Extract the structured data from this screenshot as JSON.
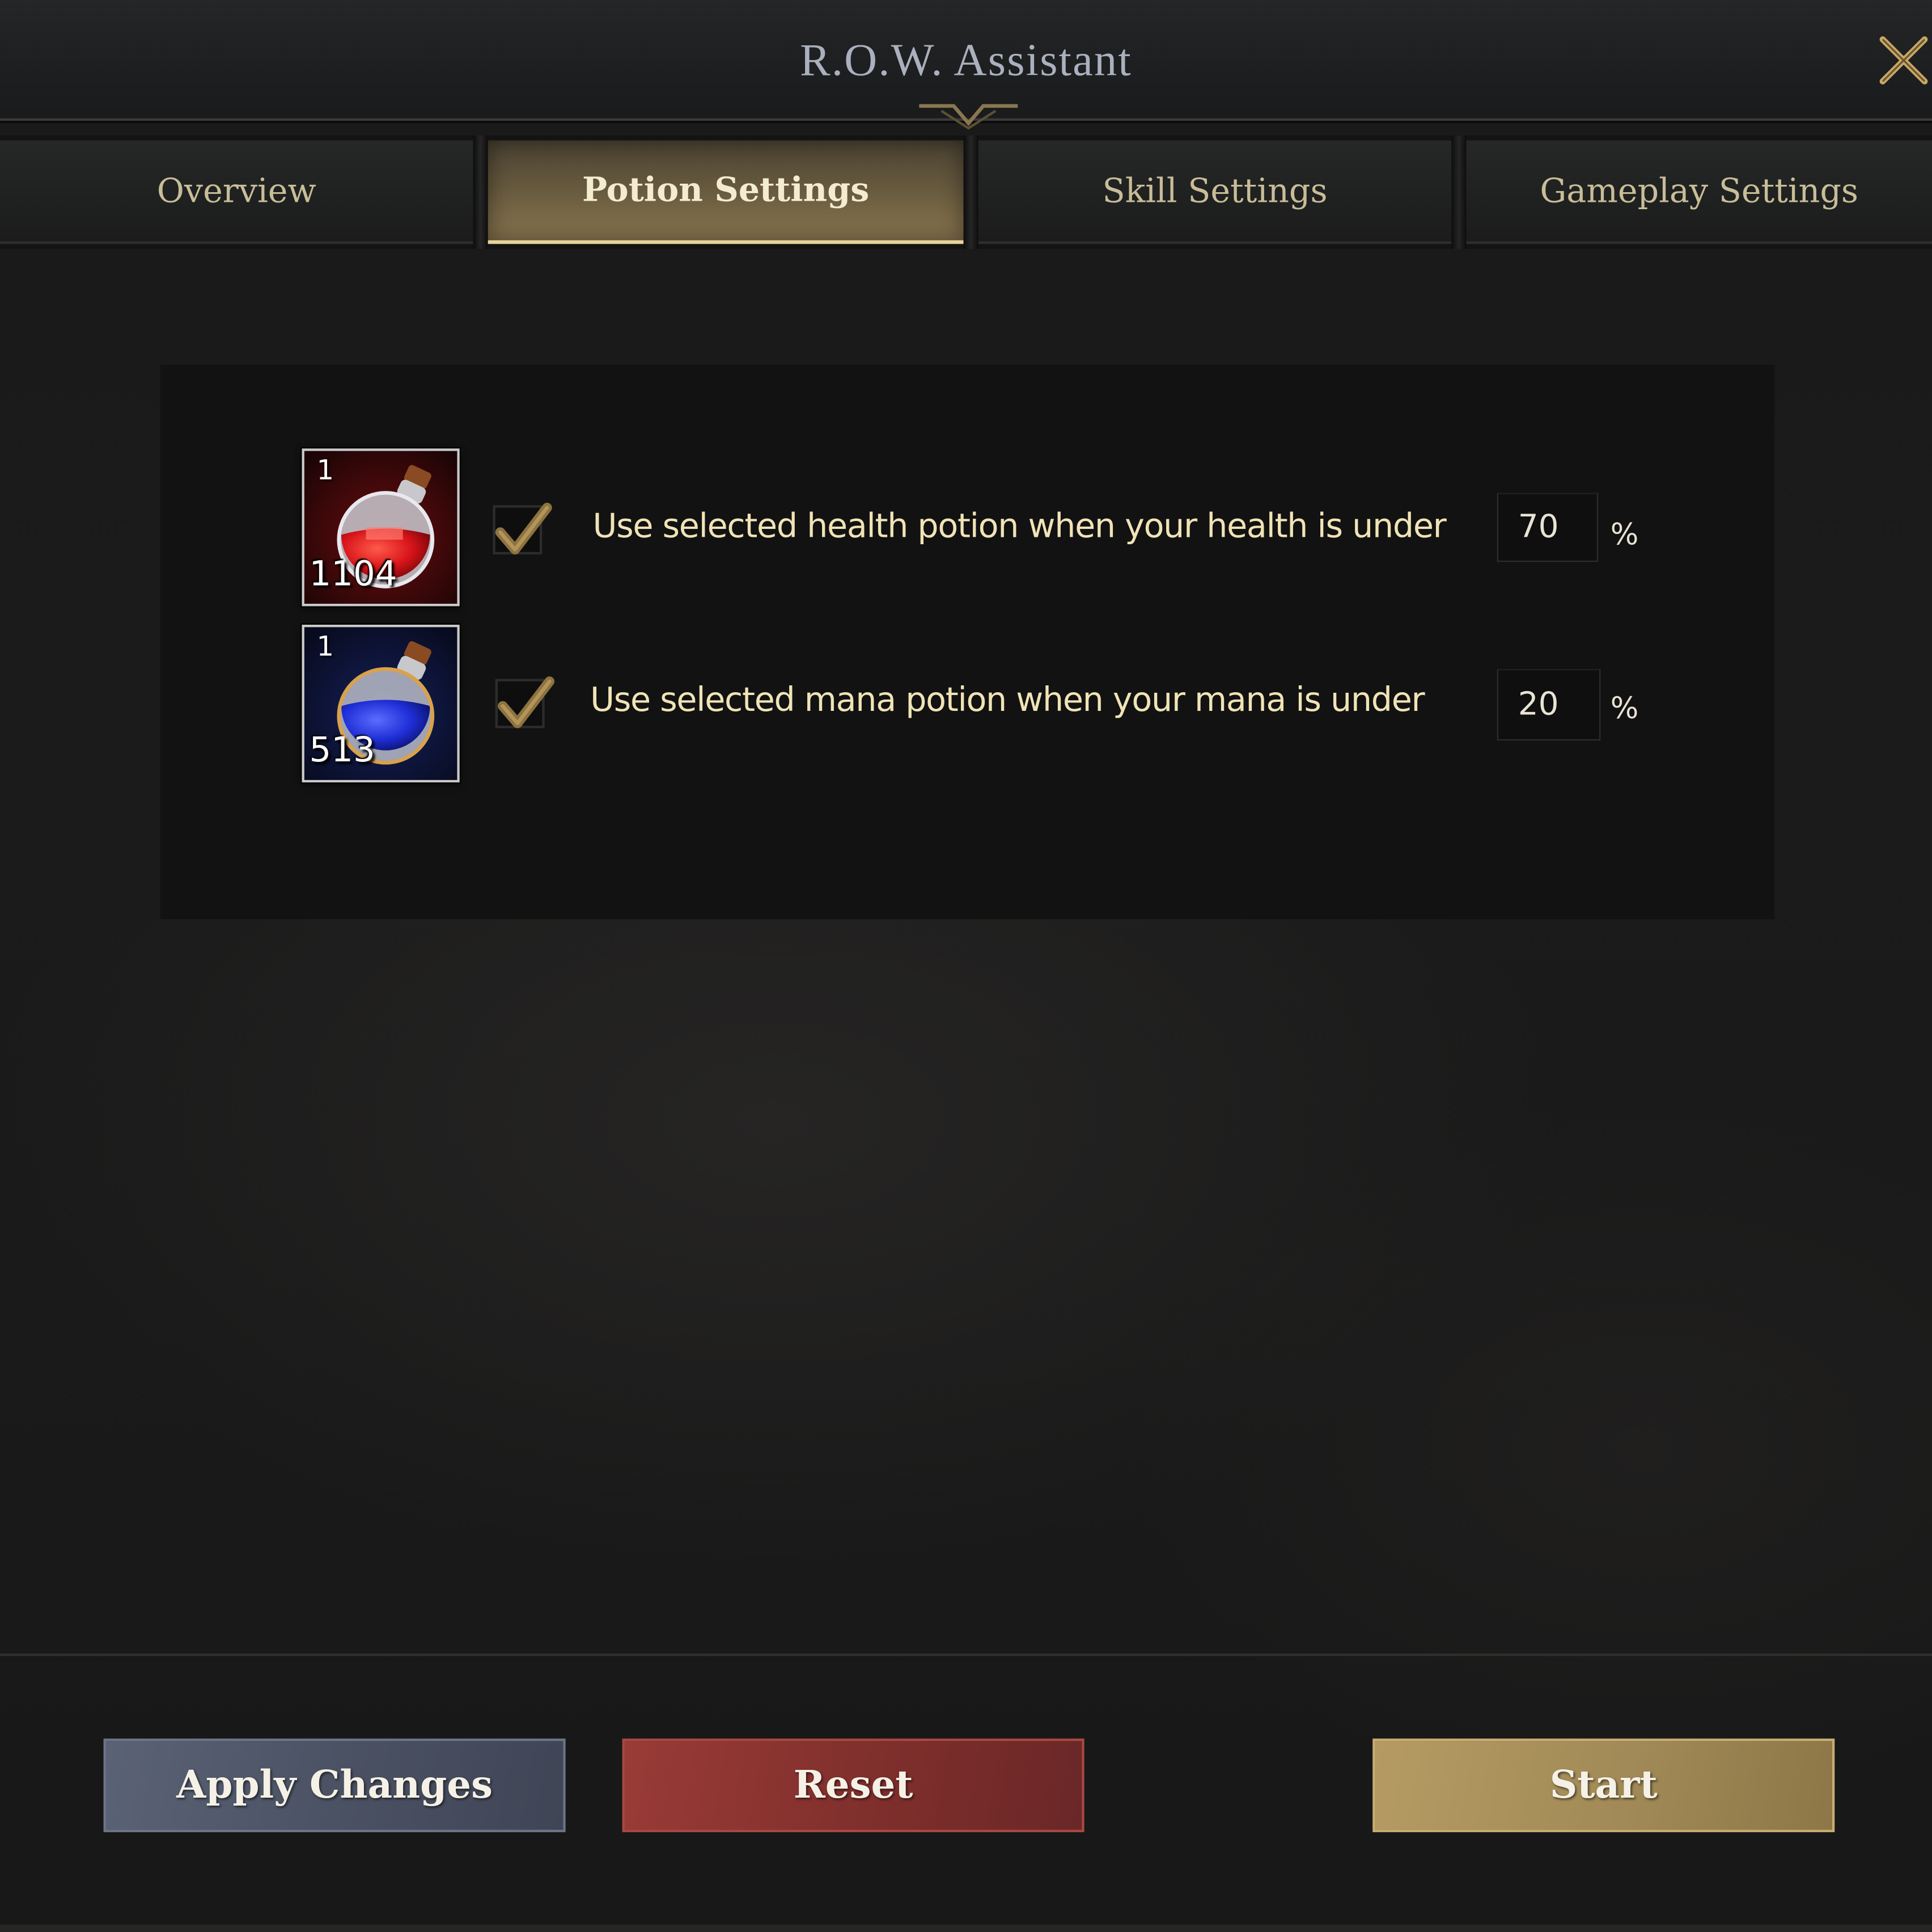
{
  "window": {
    "title": "R.O.W. Assistant"
  },
  "tabs": [
    {
      "label": "Overview",
      "active": false
    },
    {
      "label": "Potion Settings",
      "active": true
    },
    {
      "label": "Skill Settings",
      "active": false
    },
    {
      "label": "Gameplay Settings",
      "active": false
    }
  ],
  "potions": [
    {
      "type": "health",
      "level": "1",
      "count": "1104",
      "enabled": true,
      "label": "Use selected health potion when your health is under",
      "threshold": "70",
      "unit": "%"
    },
    {
      "type": "mana",
      "level": "1",
      "count": "513",
      "enabled": true,
      "label": "Use selected mana potion when your mana is under",
      "threshold": "20",
      "unit": "%"
    }
  ],
  "buttons": {
    "apply": "Apply Changes",
    "reset": "Reset",
    "start": "Start"
  },
  "icons": {
    "close": "close-x-icon",
    "health_potion": "red-potion-icon",
    "mana_potion": "blue-potion-icon",
    "checkmark": "checkmark-icon"
  },
  "colors": {
    "accent_gold": "#e6d39a",
    "text_cream": "#f0e3b6",
    "apply_blue": "#4b5264",
    "reset_red": "#7f2f2c",
    "start_gold": "#a18a57"
  }
}
